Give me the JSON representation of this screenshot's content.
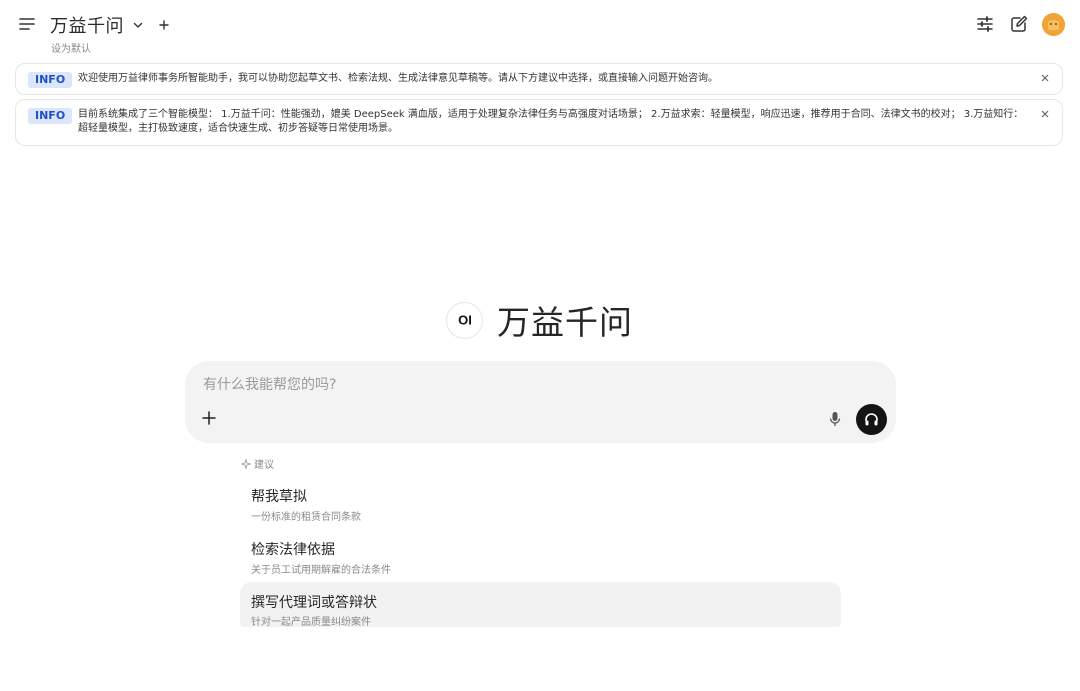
{
  "header": {
    "model_name": "万益千问",
    "set_default": "设为默认"
  },
  "banners": [
    {
      "badge": "INFO",
      "text": "欢迎使用万益律师事务所智能助手，我可以协助您起草文书、检索法规、生成法律意见草稿等。请从下方建议中选择，或直接输入问题开始咨询。"
    },
    {
      "badge": "INFO",
      "text": "目前系统集成了三个智能模型： 1.万益千问：性能强劲，媲美 DeepSeek 满血版，适用于处理复杂法律任务与高强度对话场景； 2.万益求索：轻量模型，响应迅速，推荐用于合同、法律文书的校对； 3.万益知行：超轻量模型，主打极致速度，适合快速生成、初步答疑等日常使用场景。"
    }
  ],
  "brand": {
    "logo_text": "OI",
    "name": "万益千问"
  },
  "chat": {
    "placeholder": "有什么我能帮您的吗?"
  },
  "suggestions": {
    "header": "建议",
    "items": [
      {
        "title": "帮我草拟",
        "subtitle": "一份标准的租赁合同条款"
      },
      {
        "title": "检索法律依据",
        "subtitle": "关于员工试用期解雇的合法条件"
      },
      {
        "title": "撰写代理词或答辩状",
        "subtitle": "针对一起产品质量纠纷案件"
      }
    ]
  },
  "colors": {
    "info_badge_bg": "#dbe6fb",
    "info_badge_text": "#1e51c2",
    "avatar": "#f1a338",
    "voice_button": "#141414",
    "input_bg": "#f3f3f3"
  },
  "icons": [
    "menu-icon",
    "chevron-down-icon",
    "plus-icon",
    "sliders-icon",
    "edit-icon",
    "avatar",
    "close-icon",
    "microphone-icon",
    "headphones-icon",
    "sparkle-icon"
  ]
}
